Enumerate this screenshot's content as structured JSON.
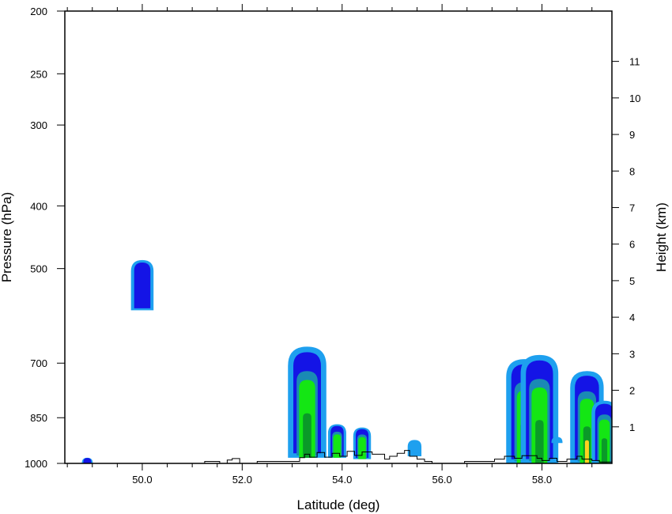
{
  "chart_data": {
    "type": "area",
    "subtype": "vertical cross-section filled contour",
    "xlabel": "Latitude (deg)",
    "ylabel_left": "Pressure (hPa)",
    "ylabel_right": "Height (km)",
    "xlim": [
      48.45,
      59.4
    ],
    "ylim_pressure": [
      1000,
      200
    ],
    "y_scale_left": "log",
    "x_ticks": [
      50.0,
      52.0,
      54.0,
      56.0,
      58.0
    ],
    "x_tick_labels": [
      "50.0",
      "52.0",
      "54.0",
      "56.0",
      "58.0"
    ],
    "y_ticks_left": [
      200,
      250,
      300,
      400,
      500,
      700,
      850,
      1000
    ],
    "y_tick_labels_left": [
      "200",
      "250",
      "300",
      "400",
      "500",
      "700",
      "850",
      "1000"
    ],
    "y_ticks_right_km": [
      1,
      2,
      3,
      4,
      5,
      6,
      7,
      8,
      9,
      10,
      11
    ],
    "y_tick_labels_right": [
      "1",
      "2",
      "3",
      "4",
      "5",
      "6",
      "7",
      "8",
      "9",
      "10",
      "11"
    ],
    "grid": false,
    "legend": "none",
    "colors": {
      "level_1": "#1ea0ef",
      "level_2": "#1414e6",
      "level_3": "#1a8ab4",
      "level_4": "#14e614",
      "level_5": "#0a9a28",
      "level_6": "#ffd21e",
      "terrain": "#000000"
    },
    "cells": [
      {
        "lat": 50.0,
        "top_hPa": 485,
        "bottom_hPa": 580,
        "max_level": 2
      },
      {
        "lat": 48.9,
        "top_hPa": 980,
        "bottom_hPa": 1000,
        "max_level": 2
      },
      {
        "lat": 53.3,
        "top_hPa": 660,
        "bottom_hPa": 980,
        "max_level": 5
      },
      {
        "lat": 53.9,
        "top_hPa": 870,
        "bottom_hPa": 980,
        "max_level": 4
      },
      {
        "lat": 54.4,
        "top_hPa": 880,
        "bottom_hPa": 985,
        "max_level": 4
      },
      {
        "lat": 55.45,
        "top_hPa": 920,
        "bottom_hPa": 975,
        "max_level": 1
      },
      {
        "lat": 57.65,
        "top_hPa": 690,
        "bottom_hPa": 1000,
        "max_level": 6
      },
      {
        "lat": 57.95,
        "top_hPa": 680,
        "bottom_hPa": 1000,
        "max_level": 5
      },
      {
        "lat": 58.3,
        "top_hPa": 910,
        "bottom_hPa": 930,
        "max_level": 1
      },
      {
        "lat": 58.9,
        "top_hPa": 720,
        "bottom_hPa": 1000,
        "max_level": 6
      },
      {
        "lat": 59.25,
        "top_hPa": 800,
        "bottom_hPa": 1000,
        "max_level": 5
      }
    ],
    "terrain_profile": {
      "lat": [
        48.45,
        51.25,
        51.25,
        51.55,
        51.55,
        51.7,
        51.7,
        51.8,
        51.8,
        51.95,
        51.95,
        52.3,
        52.3,
        53.15,
        53.15,
        53.25,
        53.25,
        53.35,
        53.35,
        53.5,
        53.5,
        53.65,
        53.65,
        53.8,
        53.8,
        53.95,
        53.95,
        54.1,
        54.1,
        54.25,
        54.25,
        54.4,
        54.4,
        54.6,
        54.6,
        54.85,
        54.85,
        54.95,
        54.95,
        55.1,
        55.1,
        55.25,
        55.25,
        55.35,
        55.35,
        55.5,
        55.5,
        55.65,
        55.65,
        55.8,
        55.8,
        56.45,
        56.45,
        57.05,
        57.05,
        57.25,
        57.25,
        57.45,
        57.45,
        57.6,
        57.6,
        57.9,
        57.9,
        58.0,
        58.0,
        58.15,
        58.15,
        58.3,
        58.3,
        58.5,
        58.5,
        58.7,
        58.7,
        58.8,
        58.8,
        59.0,
        59.0,
        59.15,
        59.15,
        59.4
      ],
      "pressure_hPa": [
        1000,
        1000,
        993,
        993,
        1000,
        1000,
        988,
        988,
        983,
        983,
        1000,
        1000,
        993,
        993,
        980,
        980,
        968,
        968,
        978,
        978,
        962,
        962,
        978,
        978,
        965,
        965,
        975,
        975,
        958,
        958,
        972,
        972,
        960,
        960,
        968,
        968,
        985,
        985,
        975,
        975,
        965,
        965,
        955,
        955,
        975,
        975,
        985,
        985,
        993,
        993,
        1000,
        1000,
        993,
        993,
        985,
        985,
        975,
        975,
        982,
        982,
        973,
        973,
        982,
        982,
        990,
        990,
        982,
        982,
        993,
        993,
        985,
        985,
        975,
        975,
        985,
        985,
        990,
        990,
        995,
        995
      ]
    }
  }
}
